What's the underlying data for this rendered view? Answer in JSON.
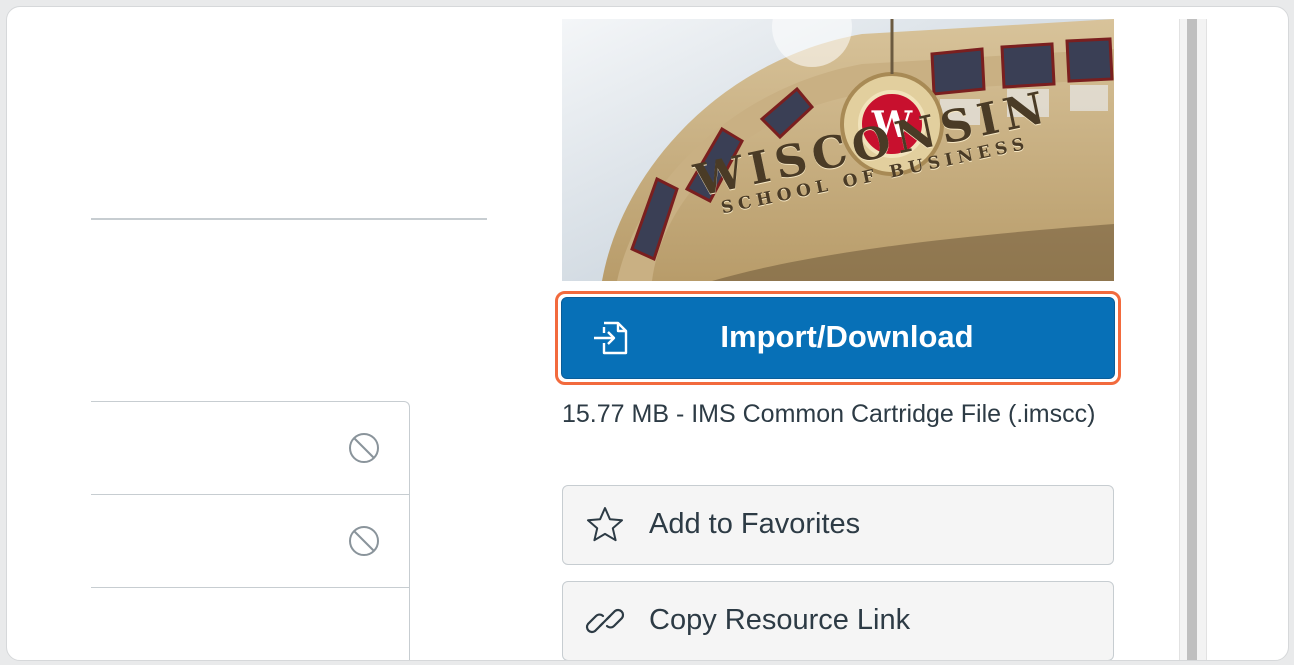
{
  "hero_image": {
    "caption_line1": "WISCONSIN",
    "caption_line2": "SCHOOL OF BUSINESS",
    "seal_letter": "W"
  },
  "import_button": {
    "label": "Import/Download",
    "icon": "import-icon"
  },
  "file_info": "15.77 MB - IMS Common Cartridge File (.imscc)",
  "actions": [
    {
      "label": "Add to Favorites",
      "icon": "star-icon"
    },
    {
      "label": "Copy Resource Link",
      "icon": "link-icon"
    }
  ],
  "list_rows": [
    {
      "icon": "blocked-icon"
    },
    {
      "icon": "blocked-icon"
    },
    {
      "icon": ""
    }
  ],
  "colors": {
    "primary": "#0770b7",
    "highlight": "#f26a3d",
    "text": "#2d3b45",
    "border": "#c7cdd1"
  }
}
